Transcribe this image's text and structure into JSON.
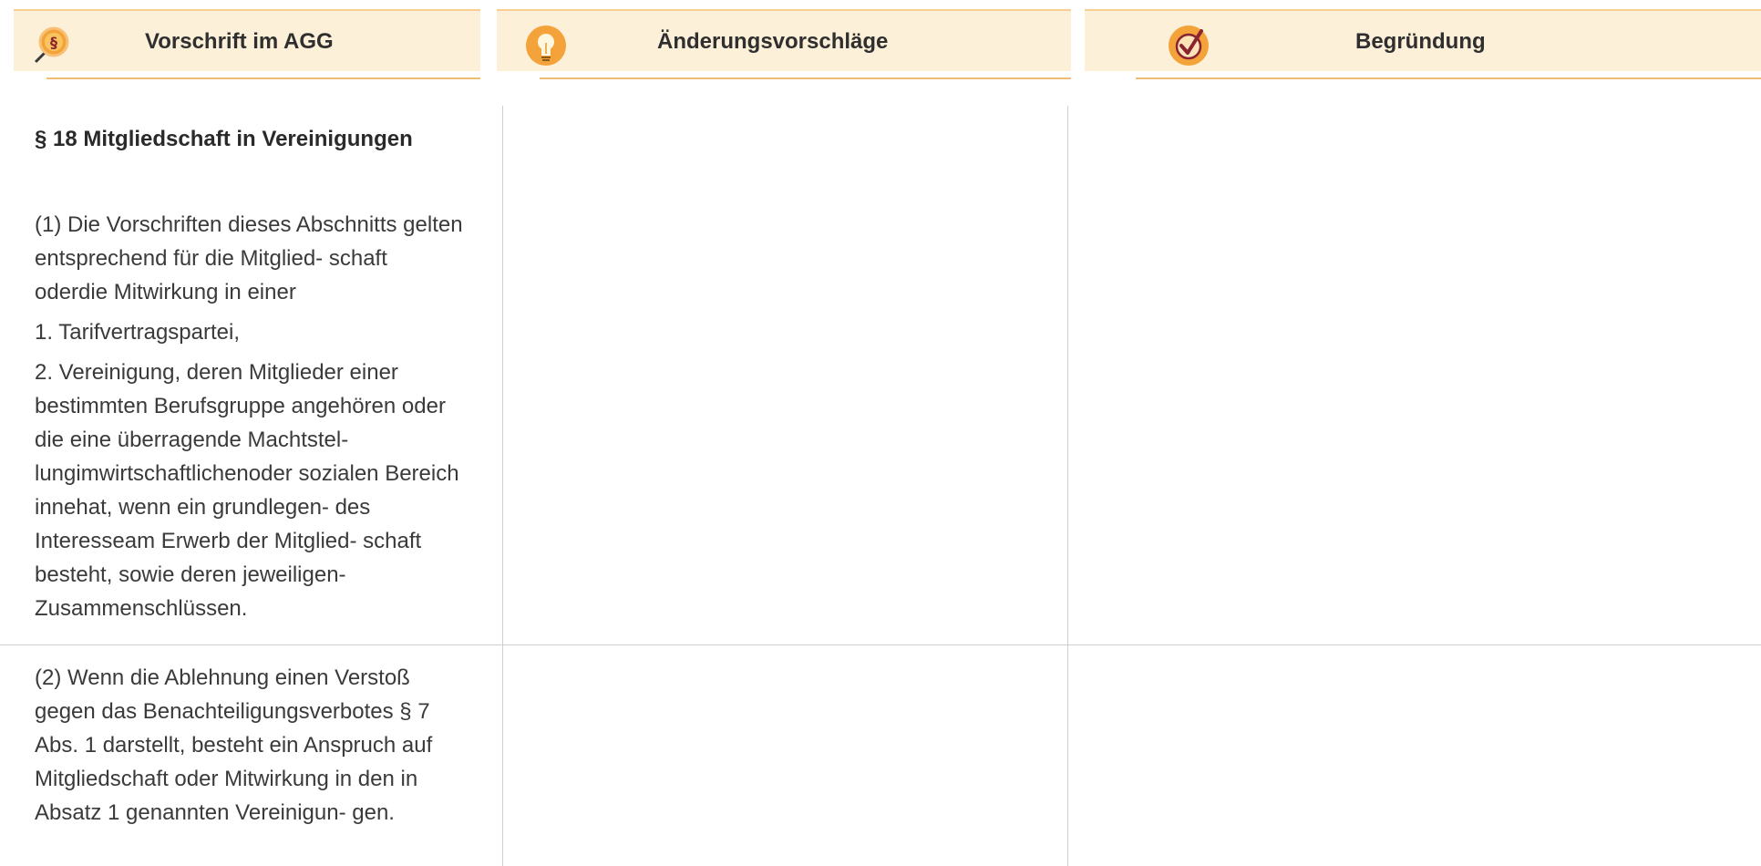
{
  "headers": [
    {
      "title": "Vorschrift im AGG",
      "icon": "magnifier-paragraph-icon"
    },
    {
      "title": "Änderungsvorschläge",
      "icon": "lightbulb-icon"
    },
    {
      "title": "Begründung",
      "icon": "checkmark-icon"
    }
  ],
  "section": {
    "heading": "§ 18 Mitgliedschaft in Vereinigungen",
    "paragraph1_intro": "(1) Die Vorschriften dieses Abschnitts gelten entsprechend für die Mitglied- schaft oderdie Mitwirkung in einer",
    "item1": "1. Tarifvertragspartei,",
    "item2": "2. Vereinigung, deren Mitglieder einer bestimmten Berufsgruppe angehören oder die eine überragende Machtstel- lungimwirtschaftlichenoder sozialen Bereich innehat, wenn ein grundlegen- des Interesseam Erwerb der Mitglied- schaft besteht, sowie deren jeweiligen- Zusammenschlüssen.",
    "paragraph2": "(2) Wenn die Ablehnung einen Verstoß gegen das Benachteiligungsverbotes § 7 Abs. 1 darstellt, besteht ein Anspruch auf Mitgliedschaft oder Mitwirkung in den in Absatz 1 genannten Vereinigun- gen."
  },
  "colors": {
    "header_bg": "#fdf0d9",
    "header_line": "#efbc74",
    "icon_orange": "#f4a23a",
    "check_red": "#8a2430"
  }
}
